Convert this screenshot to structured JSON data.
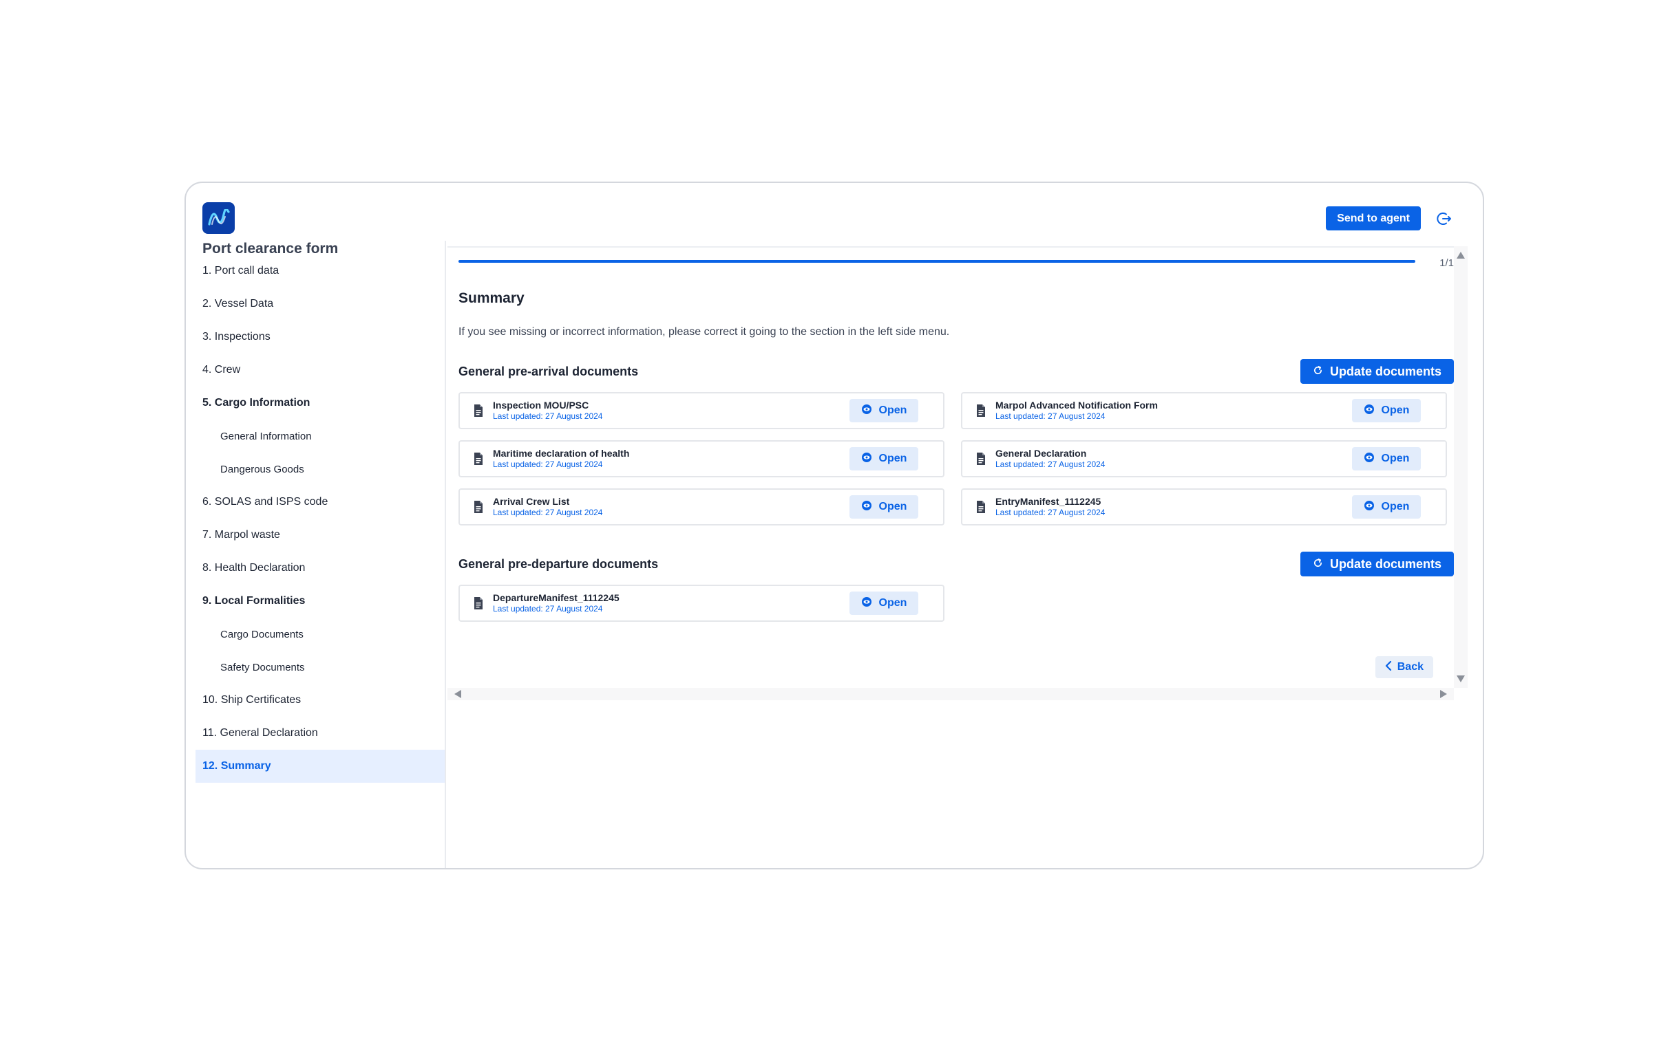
{
  "header": {
    "send_label": "Send to agent"
  },
  "sidebar": {
    "title": "Port clearance form",
    "items": [
      {
        "label": "1. Port call data",
        "sub": false,
        "bold": false,
        "active": false
      },
      {
        "label": "2. Vessel Data",
        "sub": false,
        "bold": false,
        "active": false
      },
      {
        "label": "3. Inspections",
        "sub": false,
        "bold": false,
        "active": false
      },
      {
        "label": "4. Crew",
        "sub": false,
        "bold": false,
        "active": false
      },
      {
        "label": "5. Cargo Information",
        "sub": false,
        "bold": true,
        "active": false
      },
      {
        "label": "General Information",
        "sub": true,
        "bold": false,
        "active": false
      },
      {
        "label": "Dangerous Goods",
        "sub": true,
        "bold": false,
        "active": false
      },
      {
        "label": "6. SOLAS and ISPS code",
        "sub": false,
        "bold": false,
        "active": false
      },
      {
        "label": "7. Marpol waste",
        "sub": false,
        "bold": false,
        "active": false
      },
      {
        "label": "8. Health Declaration",
        "sub": false,
        "bold": false,
        "active": false
      },
      {
        "label": "9. Local Formalities",
        "sub": false,
        "bold": true,
        "active": false
      },
      {
        "label": "Cargo Documents",
        "sub": true,
        "bold": false,
        "active": false
      },
      {
        "label": "Safety Documents",
        "sub": true,
        "bold": false,
        "active": false
      },
      {
        "label": "10. Ship Certificates",
        "sub": false,
        "bold": false,
        "active": false
      },
      {
        "label": "11. General Declaration",
        "sub": false,
        "bold": false,
        "active": false
      },
      {
        "label": "12. Summary",
        "sub": false,
        "bold": true,
        "active": true
      }
    ]
  },
  "main": {
    "page_count": "1/1",
    "title": "Summary",
    "instructions": "If you see missing or incorrect information, please correct it going to the section in the left side menu.",
    "arrival": {
      "heading": "General pre-arrival documents",
      "update_label": "Update documents",
      "docs": [
        {
          "name": "Inspection MOU/PSC",
          "date": "Last updated: 27 August 2024",
          "open_label": "Open"
        },
        {
          "name": "Marpol Advanced Notification Form",
          "date": "Last updated: 27 August 2024",
          "open_label": "Open"
        },
        {
          "name": "Maritime declaration of health",
          "date": "Last updated: 27 August 2024",
          "open_label": "Open"
        },
        {
          "name": "General Declaration",
          "date": "Last updated: 27 August 2024",
          "open_label": "Open"
        },
        {
          "name": "Arrival Crew List",
          "date": "Last updated: 27 August 2024",
          "open_label": "Open"
        },
        {
          "name": "EntryManifest_1112245",
          "date": "Last updated: 27 August 2024",
          "open_label": "Open"
        }
      ]
    },
    "departure": {
      "heading": "General pre-departure documents",
      "update_label": "Update documents",
      "docs": [
        {
          "name": "DepartureManifest_1112245",
          "date": "Last updated: 27 August 2024",
          "open_label": "Open"
        }
      ]
    },
    "back_label": "Back"
  },
  "colors": {
    "primary": "#0a63e6",
    "logo_bg": "#0a3ea8",
    "active_bg": "#e6efff",
    "open_bg": "#e2ecfb"
  },
  "icons": {
    "logo": "wave-logo-icon",
    "logout": "logout-icon",
    "doc": "file-icon",
    "open": "eye-icon",
    "update": "refresh-icon",
    "back": "chevron-left-icon"
  }
}
